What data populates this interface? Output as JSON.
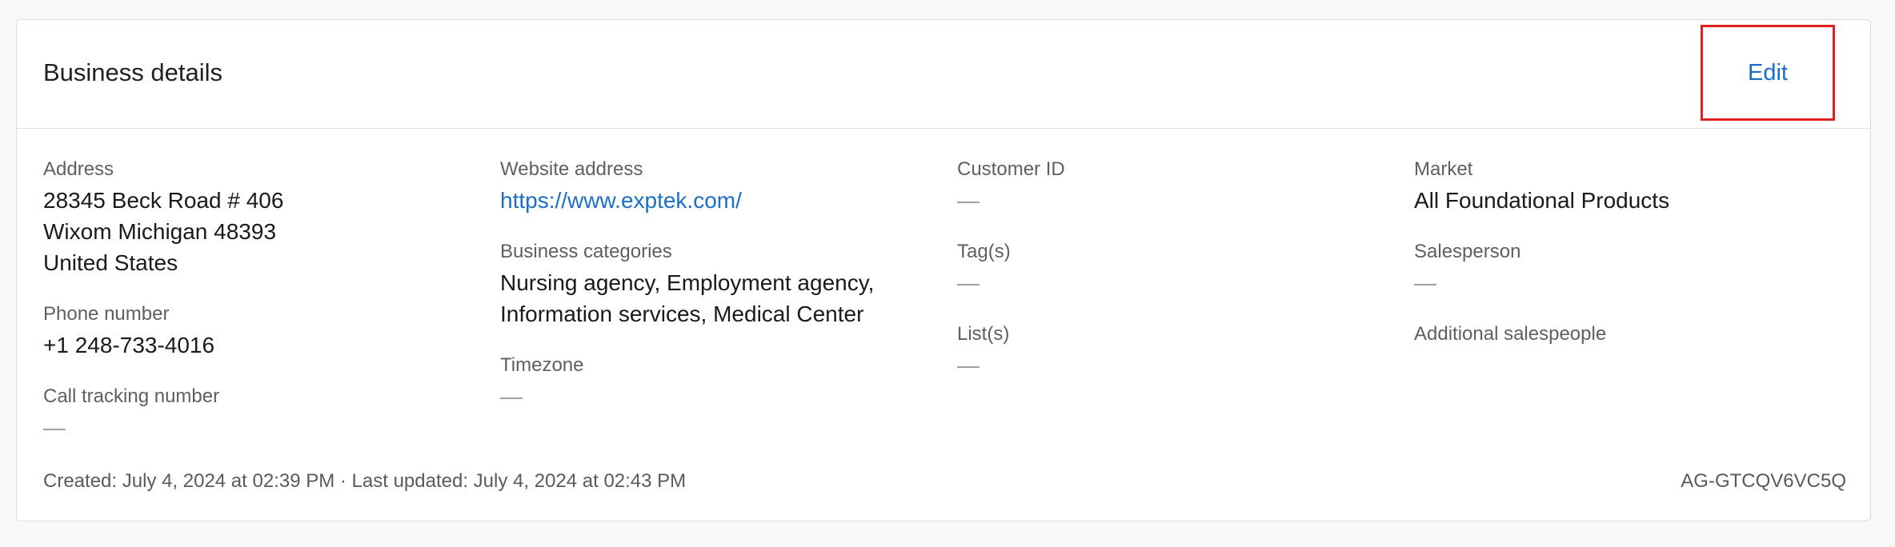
{
  "header": {
    "title": "Business details",
    "edit_label": "Edit"
  },
  "address": {
    "label": "Address",
    "lines": [
      "28345 Beck Road # 406",
      "Wixom Michigan 48393",
      "United States"
    ]
  },
  "phone": {
    "label": "Phone number",
    "value": "+1 248-733-4016"
  },
  "call_tracking": {
    "label": "Call tracking number",
    "value": "—"
  },
  "website": {
    "label": "Website address",
    "value": "https://www.exptek.com/"
  },
  "business_categories": {
    "label": "Business categories",
    "lines": [
      "Nursing agency, Employment agency,",
      "Information services, Medical Center"
    ]
  },
  "timezone": {
    "label": "Timezone",
    "value": "—"
  },
  "customer_id": {
    "label": "Customer ID",
    "value": "—"
  },
  "tags": {
    "label": "Tag(s)",
    "value": "—"
  },
  "lists": {
    "label": "List(s)",
    "value": "—"
  },
  "market": {
    "label": "Market",
    "value": "All Foundational Products"
  },
  "salesperson": {
    "label": "Salesperson",
    "value": "—"
  },
  "additional_salespeople": {
    "label": "Additional salespeople"
  },
  "footer": {
    "timestamps": "Created: July 4, 2024 at 02:39 PM · Last updated: July 4, 2024 at 02:43 PM",
    "account_id": "AG-GTCQV6VC5Q"
  },
  "colors": {
    "link": "#1a6fc9",
    "highlight_border": "#e02020"
  }
}
